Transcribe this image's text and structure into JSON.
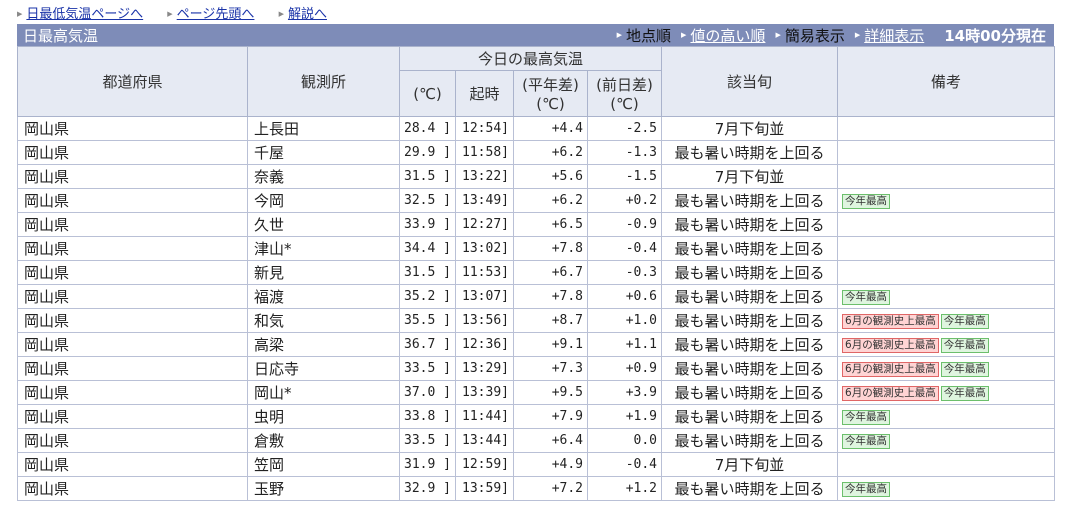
{
  "top_links": [
    "日最低気温ページへ",
    "ページ先頭へ",
    "解説へ"
  ],
  "title": "日最高気温",
  "sort": {
    "current": "地点順",
    "link": "値の高い順"
  },
  "display": {
    "current": "簡易表示",
    "link": "詳細表示"
  },
  "time_label": "14時00分現在",
  "headers": {
    "pref": "都道府県",
    "station": "観測所",
    "group": "今日の最高気温",
    "celsius": "(℃)",
    "time": "起時",
    "normal_diff_1": "(平年差)",
    "normal_diff_2": "(℃)",
    "prev_diff_1": "(前日差)",
    "prev_diff_2": "(℃)",
    "season": "該当旬",
    "note": "備考"
  },
  "badge_colors": {
    "red": "#ffd4d4",
    "green": "#dff5df"
  },
  "rows": [
    {
      "pref": "岡山県",
      "station": "上長田",
      "temp": "28.4 ]",
      "time": "12:54]",
      "normal": "+4.4",
      "prev": "-2.5",
      "season": "7月下旬並",
      "badges": []
    },
    {
      "pref": "岡山県",
      "station": "千屋",
      "temp": "29.9 ]",
      "time": "11:58]",
      "normal": "+6.2",
      "prev": "-1.3",
      "season": "最も暑い時期を上回る",
      "badges": []
    },
    {
      "pref": "岡山県",
      "station": "奈義",
      "temp": "31.5 ]",
      "time": "13:22]",
      "normal": "+5.6",
      "prev": "-1.5",
      "season": "7月下旬並",
      "badges": []
    },
    {
      "pref": "岡山県",
      "station": "今岡",
      "temp": "32.5 ]",
      "time": "13:49]",
      "normal": "+6.2",
      "prev": "+0.2",
      "season": "最も暑い時期を上回る",
      "badges": [
        {
          "text": "今年最高",
          "color": "green"
        }
      ]
    },
    {
      "pref": "岡山県",
      "station": "久世",
      "temp": "33.9 ]",
      "time": "12:27]",
      "normal": "+6.5",
      "prev": "-0.9",
      "season": "最も暑い時期を上回る",
      "badges": []
    },
    {
      "pref": "岡山県",
      "station": "津山*",
      "temp": "34.4 ]",
      "time": "13:02]",
      "normal": "+7.8",
      "prev": "-0.4",
      "season": "最も暑い時期を上回る",
      "badges": []
    },
    {
      "pref": "岡山県",
      "station": "新見",
      "temp": "31.5 ]",
      "time": "11:53]",
      "normal": "+6.7",
      "prev": "-0.3",
      "season": "最も暑い時期を上回る",
      "badges": []
    },
    {
      "pref": "岡山県",
      "station": "福渡",
      "temp": "35.2 ]",
      "time": "13:07]",
      "normal": "+7.8",
      "prev": "+0.6",
      "season": "最も暑い時期を上回る",
      "badges": [
        {
          "text": "今年最高",
          "color": "green"
        }
      ]
    },
    {
      "pref": "岡山県",
      "station": "和気",
      "temp": "35.5 ]",
      "time": "13:56]",
      "normal": "+8.7",
      "prev": "+1.0",
      "season": "最も暑い時期を上回る",
      "badges": [
        {
          "text": "6月の観測史上最高",
          "color": "red"
        },
        {
          "text": "今年最高",
          "color": "green"
        }
      ]
    },
    {
      "pref": "岡山県",
      "station": "高梁",
      "temp": "36.7 ]",
      "time": "12:36]",
      "normal": "+9.1",
      "prev": "+1.1",
      "season": "最も暑い時期を上回る",
      "badges": [
        {
          "text": "6月の観測史上最高",
          "color": "red"
        },
        {
          "text": "今年最高",
          "color": "green"
        }
      ]
    },
    {
      "pref": "岡山県",
      "station": "日応寺",
      "temp": "33.5 ]",
      "time": "13:29]",
      "normal": "+7.3",
      "prev": "+0.9",
      "season": "最も暑い時期を上回る",
      "badges": [
        {
          "text": "6月の観測史上最高",
          "color": "red"
        },
        {
          "text": "今年最高",
          "color": "green"
        }
      ]
    },
    {
      "pref": "岡山県",
      "station": "岡山*",
      "temp": "37.0 ]",
      "time": "13:39]",
      "normal": "+9.5",
      "prev": "+3.9",
      "season": "最も暑い時期を上回る",
      "badges": [
        {
          "text": "6月の観測史上最高",
          "color": "red"
        },
        {
          "text": "今年最高",
          "color": "green"
        }
      ]
    },
    {
      "pref": "岡山県",
      "station": "虫明",
      "temp": "33.8 ]",
      "time": "11:44]",
      "normal": "+7.9",
      "prev": "+1.9",
      "season": "最も暑い時期を上回る",
      "badges": [
        {
          "text": "今年最高",
          "color": "green"
        }
      ]
    },
    {
      "pref": "岡山県",
      "station": "倉敷",
      "temp": "33.5 ]",
      "time": "13:44]",
      "normal": "+6.4",
      "prev": "0.0",
      "season": "最も暑い時期を上回る",
      "badges": [
        {
          "text": "今年最高",
          "color": "green"
        }
      ]
    },
    {
      "pref": "岡山県",
      "station": "笠岡",
      "temp": "31.9 ]",
      "time": "12:59]",
      "normal": "+4.9",
      "prev": "-0.4",
      "season": "7月下旬並",
      "badges": []
    },
    {
      "pref": "岡山県",
      "station": "玉野",
      "temp": "32.9 ]",
      "time": "13:59]",
      "normal": "+7.2",
      "prev": "+1.2",
      "season": "最も暑い時期を上回る",
      "badges": [
        {
          "text": "今年最高",
          "color": "green"
        }
      ]
    }
  ]
}
